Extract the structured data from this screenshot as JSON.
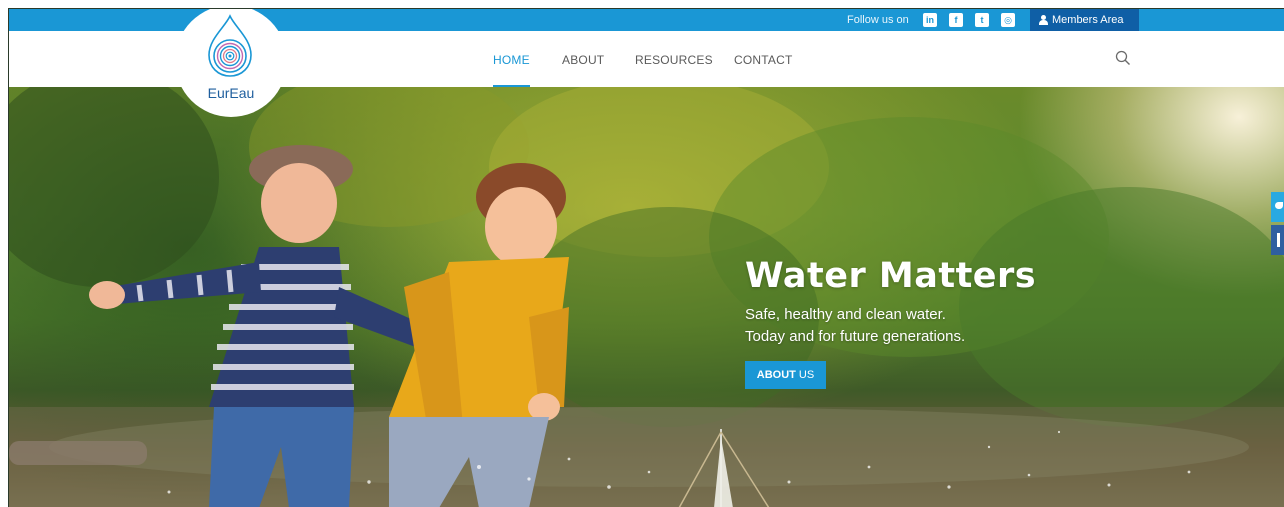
{
  "topbar": {
    "follow_text": "Follow us on",
    "social": [
      {
        "icon": "linkedin-icon",
        "glyph": "in"
      },
      {
        "icon": "facebook-icon",
        "glyph": "f"
      },
      {
        "icon": "twitter-icon",
        "glyph": "t"
      },
      {
        "icon": "instagram-icon",
        "glyph": "◎"
      }
    ],
    "members_label": "Members Area",
    "bar_color": "#1a97d5",
    "members_color": "#0f5fa6"
  },
  "logo": {
    "text": "EurEau",
    "icon": "water-drop-icon"
  },
  "nav": {
    "items": [
      {
        "label": "HOME",
        "active": true
      },
      {
        "label": "ABOUT",
        "active": false
      },
      {
        "label": "RESOURCES",
        "active": false
      },
      {
        "label": "CONTACT",
        "active": false
      }
    ],
    "search_icon": "search-icon",
    "accent_color": "#1a97d5"
  },
  "hero": {
    "title": "Water Matters",
    "line1": "Safe, healthy and clean water.",
    "line2": "Today and for future generations.",
    "button_bold": "ABOUT",
    "button_rest": " US"
  },
  "share": {
    "twitter_icon": "twitter-share-icon",
    "facebook_icon": "facebook-share-icon"
  }
}
